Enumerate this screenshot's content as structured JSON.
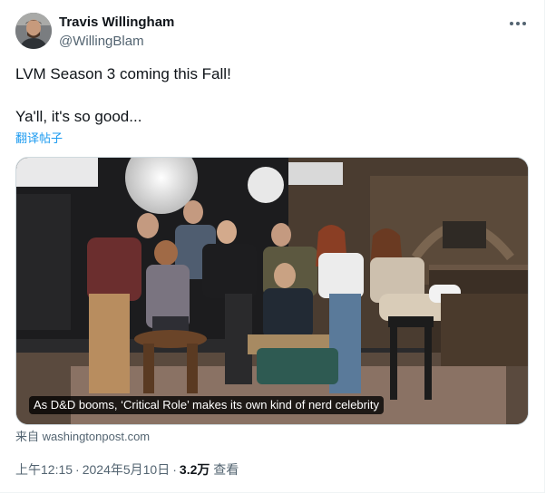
{
  "author": {
    "display_name": "Travis Willingham",
    "handle": "@WillingBlam"
  },
  "tweet": {
    "line1": "LVM Season 3 coming this Fall!",
    "line2": "Ya'll, it's so good...",
    "translate_label": "翻译帖子"
  },
  "media": {
    "caption": "As D&D booms, ‘Critical Role’ makes its own kind of nerd celebrity"
  },
  "card": {
    "source": "来自 washingtonpost.com"
  },
  "meta": {
    "time": "上午12:15",
    "separator": "·",
    "date": "2024年5月10日",
    "views_count": "3.2万",
    "views_label": "查看"
  },
  "icons": {
    "more": "more-horizontal-icon"
  },
  "colors": {
    "link": "#1d9bf0",
    "secondary_text": "#536471",
    "primary_text": "#0f1419"
  }
}
